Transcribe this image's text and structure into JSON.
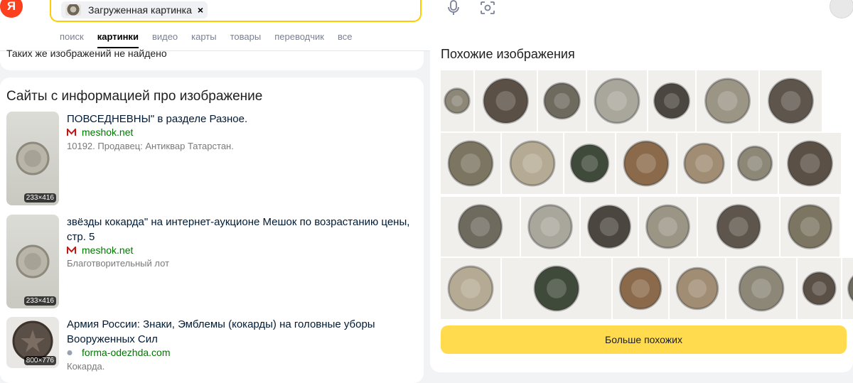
{
  "header": {
    "logo": "Я",
    "search_chip_label": "Загруженная картинка",
    "search_chip_close": "×"
  },
  "tabs": [
    {
      "label": "поиск",
      "active": false
    },
    {
      "label": "картинки",
      "active": true
    },
    {
      "label": "видео",
      "active": false
    },
    {
      "label": "карты",
      "active": false
    },
    {
      "label": "товары",
      "active": false
    },
    {
      "label": "переводчик",
      "active": false
    },
    {
      "label": "все",
      "active": false
    }
  ],
  "same_images": {
    "text": "Таких же изображений не найдено"
  },
  "sites": {
    "title": "Сайты с информацией про изображение",
    "items": [
      {
        "title": "ПОВСЕДНЕВНЫ\" в разделе Разное.",
        "host": "meshok.net",
        "host_icon": "meshok-icon",
        "desc": "10192. Продавец: Антиквар Татарстан.",
        "size": "233×416"
      },
      {
        "title": "звёзды кокарда\" на интернет-аукционе Мешок по возрастанию цены, стр. 5",
        "host": "meshok.net",
        "host_icon": "meshok-icon",
        "desc": "Благотворительный лот",
        "size": "233×416"
      },
      {
        "title": "Армия России: Знаки, Эмблемы (кокарды) на головные уборы Вооруженных Сил",
        "host": "forma-odezhda.com",
        "host_icon": "globe-icon",
        "desc": "Кокарда.",
        "size": "800×776"
      }
    ]
  },
  "similar": {
    "title": "Похожие изображения",
    "more_label": "Больше похожих",
    "tile_count": 30
  },
  "colors": {
    "accent": "#ffdb4d",
    "search_border": "#ffcc00",
    "link": "#001a34",
    "host": "#007700",
    "logo": "#fc3f1d"
  }
}
